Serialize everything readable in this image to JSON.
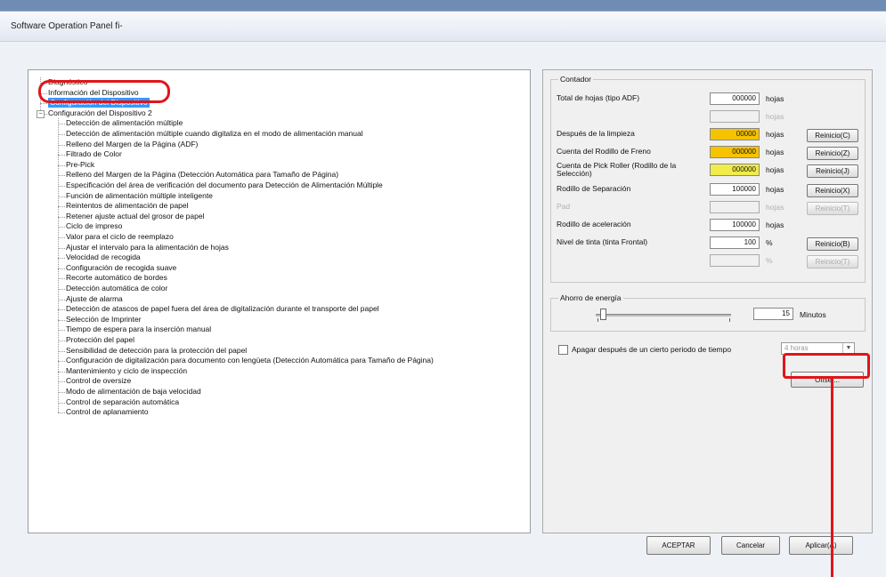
{
  "window": {
    "title": "Software Operation Panel fi-"
  },
  "tree": {
    "items": [
      "Diagnóstico",
      "Información del Dispositivo",
      "Configuración del Dispositivo",
      "Configuración del Dispositivo 2",
      "Detección de alimentación múltiple",
      "Detección de alimentación múltiple cuando digitaliza en el modo de alimentación manual",
      "Relleno del Margen de la Página (ADF)",
      "Filtrado de Color",
      "Pre-Pick",
      "Relleno del Margen de la Página (Detección Automática para Tamaño de Página)",
      "Especificación del área de verificación del documento para Detección de Alimentación Múltiple",
      "Función de alimentación múltiple inteligente",
      "Reintentos de alimentación de papel",
      "Retener ajuste actual del grosor de papel",
      "Ciclo de impreso",
      "Valor para el ciclo de reemplazo",
      "Ajustar el intervalo para la alimentación de hojas",
      "Velocidad de recogida",
      "Configuración de recogida suave",
      "Recorte automático de bordes",
      "Detección automática de color",
      "Ajuste de alarma",
      "Detección de atascos de papel fuera del área de digitalización durante el transporte del papel",
      "Selección de Imprinter",
      "Tiempo de espera para la inserción manual",
      "Protección del papel",
      "Sensibilidad de detección para la protección del papel",
      "Configuración de digitalización para documento con lengüeta (Detección Automática para Tamaño de Página)",
      "Mantenimiento y ciclo de inspección",
      "Control de oversize",
      "Modo de alimentación de baja velocidad",
      "Control de separación automática",
      "Control de aplanamiento"
    ]
  },
  "counters": {
    "title": "Contador",
    "rows": [
      {
        "label": "Total de hojas (tipo ADF)",
        "value": "000000",
        "unit": "hojas",
        "button": ""
      },
      {
        "label": "",
        "value": "",
        "unit": "hojas",
        "button": ""
      },
      {
        "label": "Después de la limpieza",
        "value": "00000",
        "unit": "hojas",
        "button": "Reinicio(C)"
      },
      {
        "label": "Cuenta del Rodillo de Freno",
        "value": "000000",
        "unit": "hojas",
        "button": "Reinicio(Z)"
      },
      {
        "label": "Cuenta de Pick Roller (Rodillo de la Selección)",
        "value": "000000",
        "unit": "hojas",
        "button": "Reinicio(J)"
      },
      {
        "label": "Rodillo de Separación",
        "value": "100000",
        "unit": "hojas",
        "button": "Reinicio(X)"
      },
      {
        "label": "Pad",
        "value": "",
        "unit": "hojas",
        "button": "Reinicio(T)"
      },
      {
        "label": "Rodillo de aceleración",
        "value": "100000",
        "unit": "hojas",
        "button": ""
      },
      {
        "label": "Nivel de tinta (tinta Frontal)",
        "value": "100",
        "unit": "%",
        "button": "Reinicio(B)"
      },
      {
        "label": "",
        "value": "",
        "unit": "%",
        "button": "Reinicio(T)"
      }
    ]
  },
  "power": {
    "title": "Ahorro de energía",
    "value": "15",
    "unit": "Minutos",
    "checkbox_label": "Apagar después de un cierto periodo de tiempo",
    "select_value": "4 horas",
    "offset_button": "Offset..."
  },
  "footer": {
    "ok": "ACEPTAR",
    "cancel": "Cancelar",
    "apply": "Aplicar(A)"
  }
}
